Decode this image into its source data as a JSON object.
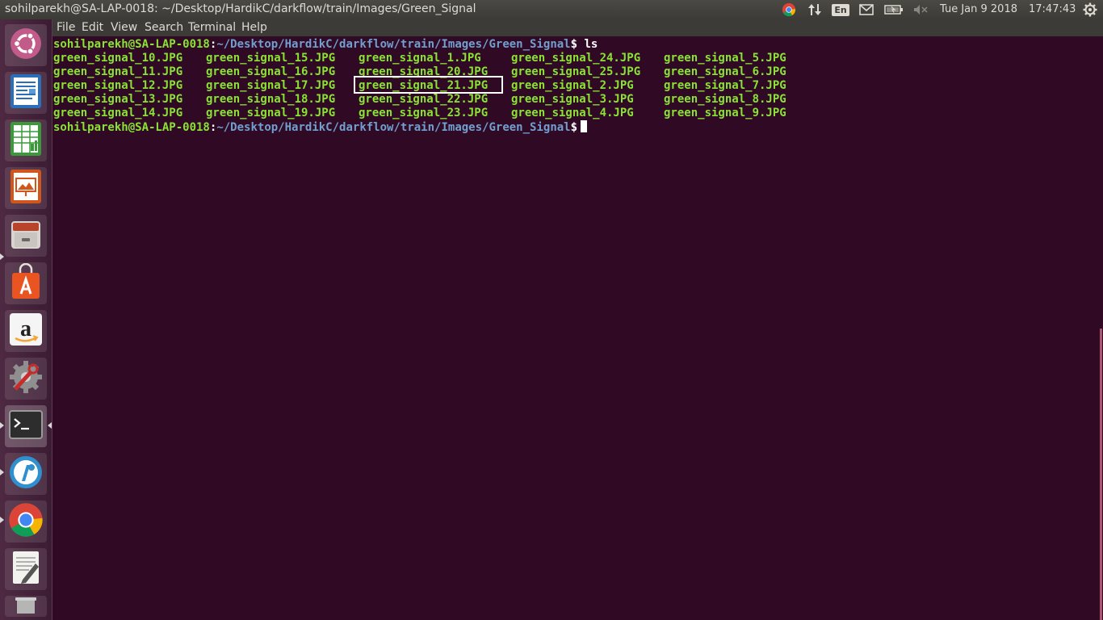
{
  "window": {
    "title": "sohilparekh@SA-LAP-0018: ~/Desktop/HardikC/darkflow/train/Images/Green_Signal"
  },
  "tray": {
    "keyboard_layout": "En",
    "date": "Tue Jan  9 2018",
    "time": "17:47:43"
  },
  "menu": {
    "file": "File",
    "edit": "Edit",
    "view": "View",
    "search": "Search",
    "terminal": "Terminal",
    "help": "Help"
  },
  "launcher": {
    "items": [
      "ubuntu-dash",
      "libreoffice-writer",
      "libreoffice-calc",
      "libreoffice-impress",
      "files",
      "ubuntu-software",
      "amazon",
      "system-settings",
      "terminal",
      "inkscape",
      "chrome",
      "text-editor",
      "trash"
    ]
  },
  "terminal": {
    "prompt_user": "sohilparekh@SA-LAP-0018",
    "prompt_sep": ":",
    "prompt_path": "~/Desktop/HardikC/darkflow/train/Images/Green_Signal",
    "prompt_end": "$",
    "command": " ls",
    "files": [
      [
        "green_signal_10.JPG",
        "green_signal_15.JPG",
        "green_signal_1.JPG",
        "green_signal_24.JPG",
        "green_signal_5.JPG"
      ],
      [
        "green_signal_11.JPG",
        "green_signal_16.JPG",
        "green_signal_20.JPG",
        "green_signal_25.JPG",
        "green_signal_6.JPG"
      ],
      [
        "green_signal_12.JPG",
        "green_signal_17.JPG",
        "green_signal_21.JPG",
        "green_signal_2.JPG",
        "green_signal_7.JPG"
      ],
      [
        "green_signal_13.JPG",
        "green_signal_18.JPG",
        "green_signal_22.JPG",
        "green_signal_3.JPG",
        "green_signal_8.JPG"
      ],
      [
        "green_signal_14.JPG",
        "green_signal_19.JPG",
        "green_signal_23.JPG",
        "green_signal_4.JPG",
        "green_signal_9.JPG"
      ]
    ],
    "highlighted_file": "green_signal_21.JPG"
  },
  "colors": {
    "background": "#300a24",
    "user": "#8ae234",
    "path": "#729fcf",
    "file": "#8ae234",
    "panel": "#3c3b37"
  }
}
